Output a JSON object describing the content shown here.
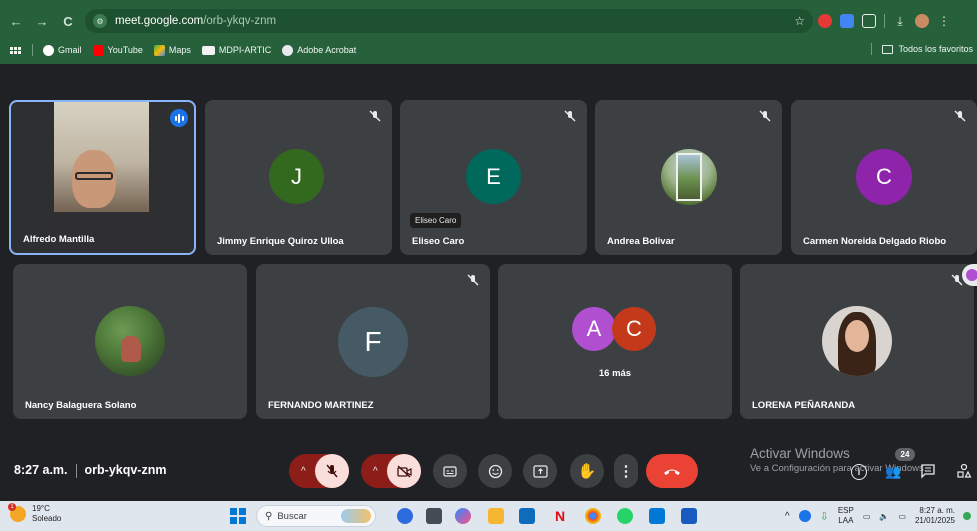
{
  "browser": {
    "nav": {
      "back": "←",
      "forward": "→",
      "reload": "C"
    },
    "url_host": "meet.google.com",
    "url_path": "/orb-ykqv-znm",
    "bookmarks": [
      {
        "label": "Gmail",
        "color": "#ea4335"
      },
      {
        "label": "YouTube",
        "color": "#ff0000"
      },
      {
        "label": "Maps",
        "color": "#34a853"
      },
      {
        "label": "MDPI-ARTIC",
        "color": "#4a4a4a"
      },
      {
        "label": "Adobe Acrobat",
        "color": "#e8eaed"
      }
    ],
    "all_bookmarks_label": "Todos los favoritos"
  },
  "participants": [
    {
      "name": "Alfredo Mantilla",
      "type": "video",
      "speaking": true
    },
    {
      "name": "Jimmy Enrique Quiroz Ulloa",
      "initial": "J",
      "color": "#33691e",
      "muted": true
    },
    {
      "name": "Eliseo Caro",
      "initial": "E",
      "color": "#00695c",
      "muted": true,
      "tooltip": "Eliseo Caro"
    },
    {
      "name": "Andrea Bolivar",
      "type": "photo",
      "muted": true
    },
    {
      "name": "Carmen Noreida Delgado Riobo",
      "initial": "C",
      "color": "#8e24aa",
      "muted": true
    },
    {
      "name": "Nancy Balaguera Solano",
      "type": "photo"
    },
    {
      "name": "FERNANDO MARTINEZ",
      "initial": "F",
      "color": "#455a64",
      "muted": true
    },
    {
      "name": "",
      "group_initials": [
        "A",
        "C"
      ],
      "group_colors": [
        "#b04fcf",
        "#c5391b"
      ],
      "more_label": "16 más"
    },
    {
      "name": "LORENA PEÑARANDA",
      "type": "photo",
      "muted": true
    }
  ],
  "meeting": {
    "time": "8:27 a.m.",
    "code": "orb-ykqv-znm",
    "participant_count": "24"
  },
  "windows_activation": {
    "title": "Activar Windows",
    "subtitle": "Ve a Configuración para activar Windows."
  },
  "taskbar": {
    "temperature": "19°C",
    "weather": "Soleado",
    "weather_badge": "1",
    "search_placeholder": "Buscar",
    "language_line1": "ESP",
    "language_line2": "LAA",
    "time": "8:27 a. m.",
    "date": "21/01/2025"
  }
}
